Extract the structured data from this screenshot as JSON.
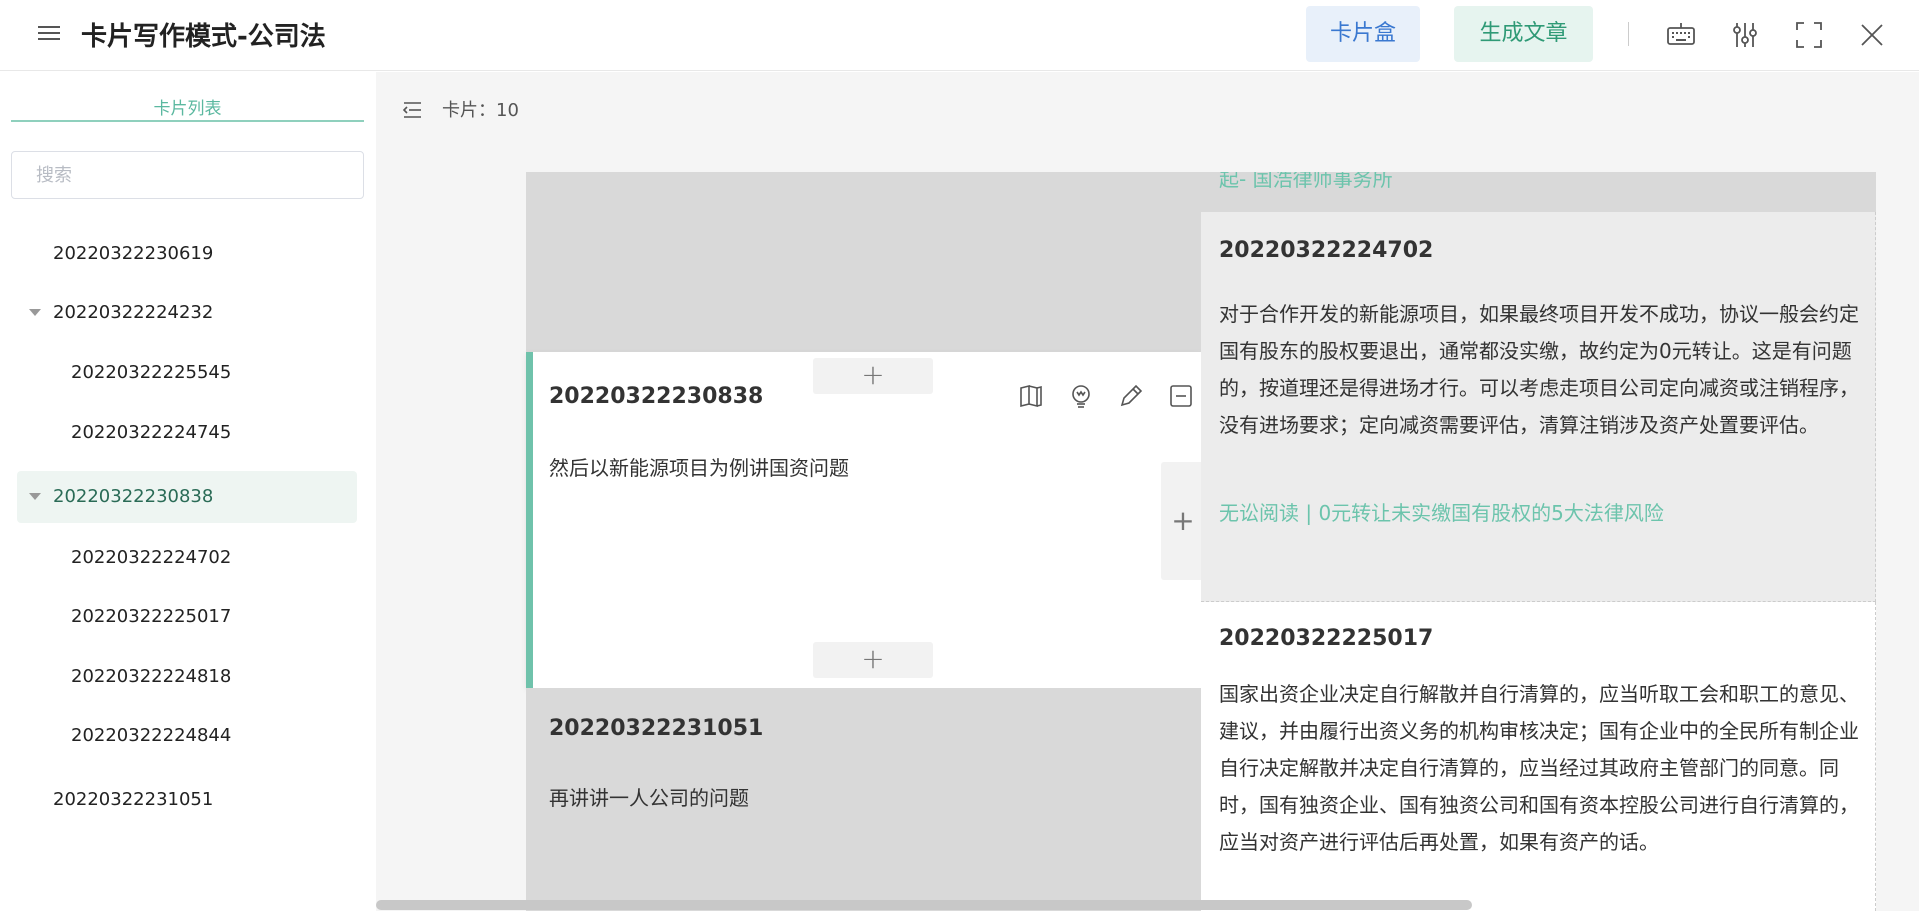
{
  "header": {
    "title": "卡片写作模式-公司法",
    "cardbox_label": "卡片盒",
    "generate_label": "生成文章"
  },
  "sidebar": {
    "tab_label": "卡片列表",
    "search_placeholder": "搜索",
    "items": [
      {
        "label": "20220322230619"
      },
      {
        "label": "20220322224232"
      },
      {
        "label": "20220322225545"
      },
      {
        "label": "20220322224745"
      },
      {
        "label": "20220322230838"
      },
      {
        "label": "20220322224702"
      },
      {
        "label": "20220322225017"
      },
      {
        "label": "20220322224818"
      },
      {
        "label": "20220322224844"
      },
      {
        "label": "20220322231051"
      }
    ]
  },
  "main": {
    "card_count": "卡片：10",
    "active_card": {
      "title": "20220322230838",
      "text": "然后以新能源项目为例讲国资问题"
    },
    "bottom_left_card": {
      "title": "20220322231051",
      "text": "再讲讲一人公司的问题"
    },
    "right_top_partial": {
      "link": "起- 国浩律师事务所"
    },
    "right_card1": {
      "title": "20220322224702",
      "text": "对于合作开发的新能源项目，如果最终项目开发不成功，协议一般会约定国有股东的股权要退出，通常都没实缴，故约定为0元转让。这是有问题的，按道理还是得进场才行。可以考虑走项目公司定向减资或注销程序，没有进场要求；定向减资需要评估，清算注销涉及资产处置要评估。",
      "link": "无讼阅读 | 0元转让未实缴国有股权的5大法律风险"
    },
    "right_card2": {
      "title": "20220322225017",
      "text": "国家出资企业决定自行解散并自行清算的，应当听取工会和职工的意见、建议，并由履行出资义务的机构审核决定；国有企业中的全民所有制企业自行决定解散并决定自行清算的，应当经过其政府主管部门的同意。同时，国有独资企业、国有独资公司和国有资本控股公司进行自行清算的，应当对资产进行评估后再处置，如果有资产的话。"
    },
    "add_symbol": "+"
  },
  "icons": {
    "menu": "menu-icon",
    "keyboard": "keyboard-icon",
    "settings": "sliders-icon",
    "fullscreen": "fullscreen-icon",
    "close": "close-icon",
    "collapse": "collapse-sidebar-icon",
    "book": "book-icon",
    "bulb": "lightbulb-icon",
    "edit": "pencil-icon",
    "remove": "minus-square-icon"
  },
  "colors": {
    "accent": "#6fc2ab",
    "cardbox_bg": "#e8f0fa",
    "generate_bg": "#e6f4ef"
  }
}
